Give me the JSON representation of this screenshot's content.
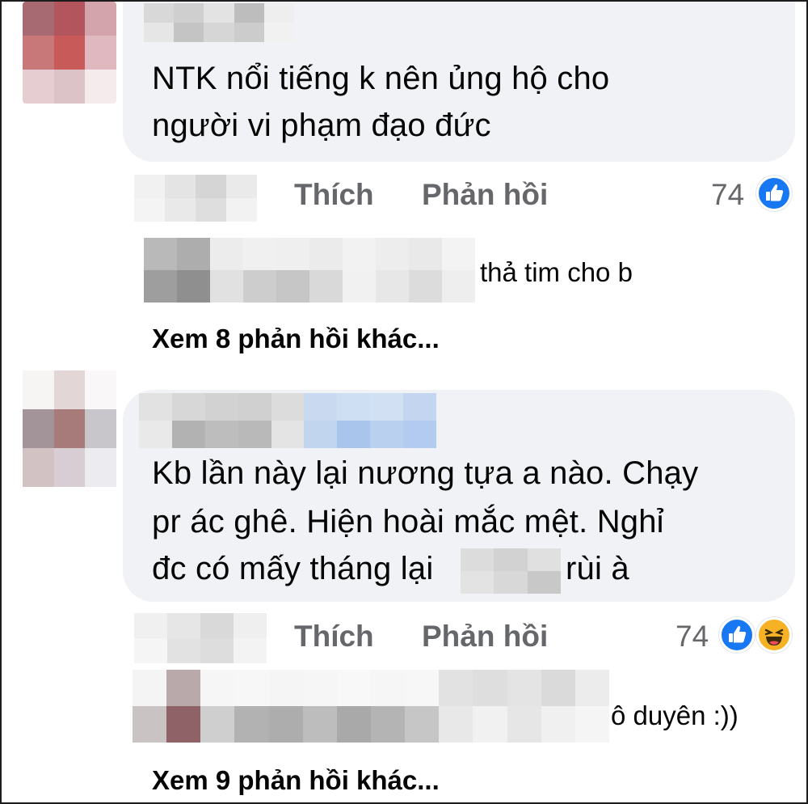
{
  "comments": [
    {
      "text_lines": [
        "NTK nổi tiếng k nên ủng hộ cho",
        "người vi phạm đạo đức"
      ],
      "actions": {
        "like": "Thích",
        "reply": "Phản hồi"
      },
      "reaction_count": "74",
      "reactions": [
        "like-icon"
      ],
      "reply_preview": "thả tim cho b",
      "more_replies": "Xem 8 phản hồi khác..."
    },
    {
      "text_lines": [
        "Kb lần này lại nương tựa a nào. Chạy",
        "pr ác ghê. Hiện hoài mắc mệt. Nghỉ",
        "đc có mấy tháng lại",
        "rùi à"
      ],
      "actions": {
        "like": "Thích",
        "reply": "Phản hồi"
      },
      "reaction_count": "74",
      "reactions": [
        "like-icon",
        "haha-icon"
      ],
      "reply_preview": "ô duyên :))",
      "more_replies": "Xem 9 phản hồi khác..."
    }
  ],
  "colors": {
    "bubble": "#f0f2f5",
    "secondary_text": "#65676b",
    "like_blue": "#1877f2",
    "haha_yellow": "#f7b125",
    "border": "#1c1c1c"
  }
}
